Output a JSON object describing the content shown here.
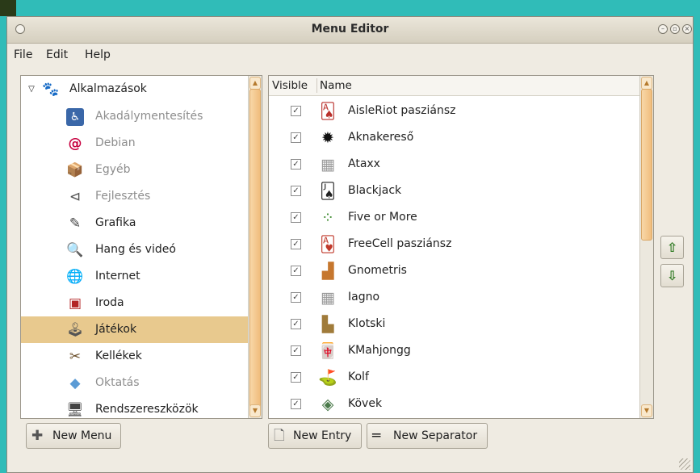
{
  "window": {
    "title": "Menu Editor"
  },
  "menubar": {
    "file": "File",
    "edit": "Edit",
    "help": "Help"
  },
  "tree": {
    "root": {
      "label": "Alkalmazások",
      "icon": "gnome-foot-icon"
    },
    "items": [
      {
        "label": "Akadálymentesítés",
        "icon": "accessibility-icon",
        "dim": true
      },
      {
        "label": "Debian",
        "icon": "debian-swirl-icon",
        "dim": true
      },
      {
        "label": "Egyéb",
        "icon": "box-icon",
        "dim": true
      },
      {
        "label": "Fejlesztés",
        "icon": "tool-icon",
        "dim": true
      },
      {
        "label": "Grafika",
        "icon": "paint-icon",
        "dim": false
      },
      {
        "label": "Hang és videó",
        "icon": "multimedia-icon",
        "dim": false
      },
      {
        "label": "Internet",
        "icon": "globe-icon",
        "dim": false
      },
      {
        "label": "Iroda",
        "icon": "office-icon",
        "dim": false
      },
      {
        "label": "Játékok",
        "icon": "joystick-icon",
        "dim": false,
        "selected": true
      },
      {
        "label": "Kellékek",
        "icon": "accessories-icon",
        "dim": false
      },
      {
        "label": "Oktatás",
        "icon": "education-icon",
        "dim": true
      },
      {
        "label": "Rendszereszközök",
        "icon": "computer-icon",
        "dim": false
      }
    ]
  },
  "list": {
    "headers": {
      "visible": "Visible",
      "name": "Name"
    },
    "items": [
      {
        "name": "AisleRiot pasziánsz",
        "icon": "cards-icon",
        "visible": true
      },
      {
        "name": "Aknakereső",
        "icon": "mine-icon",
        "visible": true
      },
      {
        "name": "Ataxx",
        "icon": "grid-board-icon",
        "visible": true
      },
      {
        "name": "Blackjack",
        "icon": "card-spade-icon",
        "visible": true
      },
      {
        "name": "Five or More",
        "icon": "balls-icon",
        "visible": true
      },
      {
        "name": "FreeCell pasziánsz",
        "icon": "card-heart-icon",
        "visible": true
      },
      {
        "name": "Gnometris",
        "icon": "blocks-icon",
        "visible": true
      },
      {
        "name": "Iagno",
        "icon": "grid-board-icon",
        "visible": true
      },
      {
        "name": "Klotski",
        "icon": "puzzle-icon",
        "visible": true
      },
      {
        "name": "KMahjongg",
        "icon": "mahjong-icon",
        "visible": true
      },
      {
        "name": "Kolf",
        "icon": "golf-flag-icon",
        "visible": true
      },
      {
        "name": "Kövek",
        "icon": "diamond-icon",
        "visible": true
      }
    ]
  },
  "buttons": {
    "new_menu": "New Menu",
    "new_entry": "New Entry",
    "new_separator": "New Separator"
  },
  "colors": {
    "selection": "#e8c98e",
    "scroll_thumb": "#f0bd7d",
    "desktop": "#30bcb8"
  }
}
